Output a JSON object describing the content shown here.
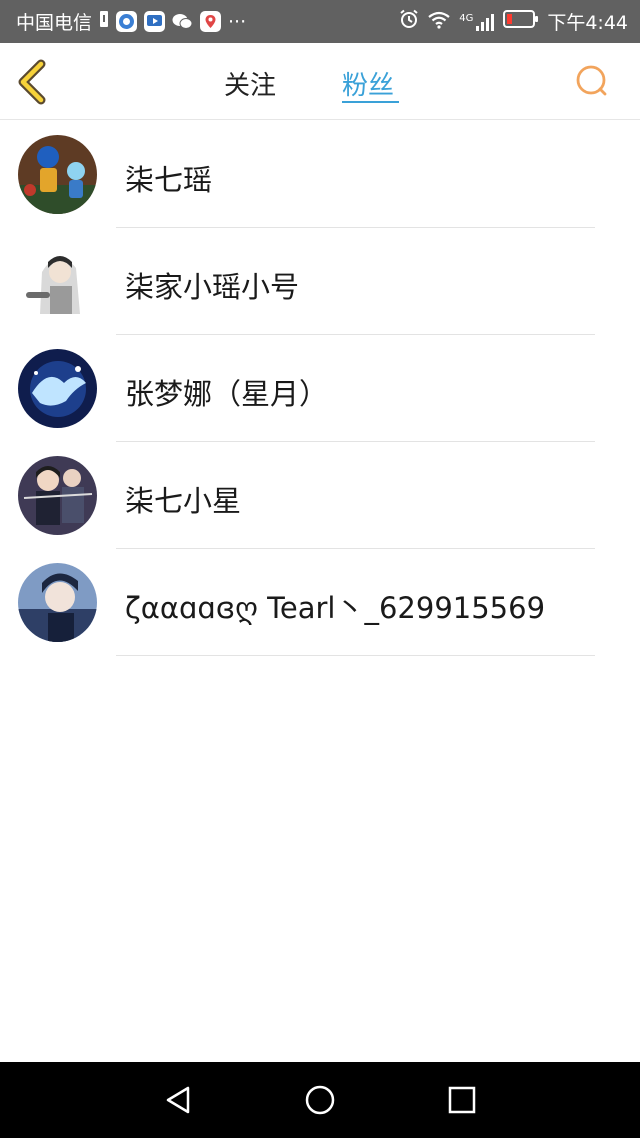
{
  "status_bar": {
    "carrier": "中国电信",
    "network": "4G",
    "time": "下午4:44",
    "more": "···"
  },
  "header": {
    "tabs": [
      {
        "label": "关注",
        "active": false
      },
      {
        "label": "粉丝",
        "active": true
      }
    ],
    "accent_color": "#3aa1d8",
    "back_icon": "chevron-left-icon",
    "search_icon": "search-icon"
  },
  "fans": [
    {
      "name": "柒七瑶"
    },
    {
      "name": "柒家小瑶小号"
    },
    {
      "name": "张梦娜（星月）"
    },
    {
      "name": "柒七小星"
    },
    {
      "name": "ζααɑɑɞღ Tearl丶_629915569"
    }
  ]
}
